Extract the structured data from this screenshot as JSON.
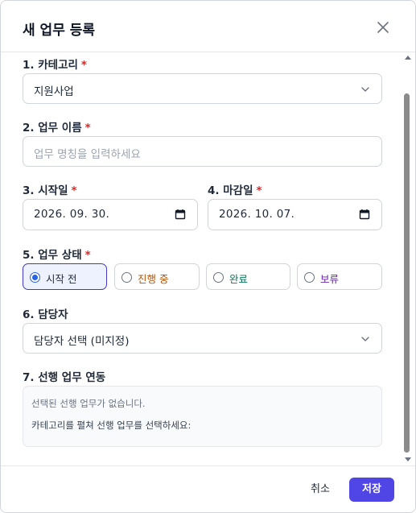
{
  "modal": {
    "title": "새 업무 등록"
  },
  "fields": {
    "category": {
      "number": "1.",
      "label": "카테고리",
      "required": "*",
      "value": "지원사업"
    },
    "task_name": {
      "number": "2.",
      "label": "업무 이름",
      "required": "*",
      "placeholder": "업무 명칭을 입력하세요"
    },
    "start_date": {
      "number": "3.",
      "label": "시작일",
      "required": "*",
      "value": "2026. 09. 30."
    },
    "due_date": {
      "number": "4.",
      "label": "마감일",
      "required": "*",
      "value": "2026. 10. 07."
    },
    "status": {
      "number": "5.",
      "label": "업무 상태",
      "required": "*",
      "options": [
        {
          "label": "시작 전",
          "color": "#1f2937",
          "selected": true
        },
        {
          "label": "진행 중",
          "color": "#b45309",
          "selected": false
        },
        {
          "label": "완료",
          "color": "#047857",
          "selected": false
        },
        {
          "label": "보류",
          "color": "#6b21a8",
          "selected": false
        }
      ]
    },
    "assignee": {
      "number": "6.",
      "label": "담당자",
      "value": "담당자 선택 (미지정)"
    },
    "predecessor": {
      "number": "7.",
      "label": "선행 업무 연동",
      "empty_text": "선택된 선행 업무가 없습니다.",
      "hint_text": "카테고리를 펼쳐 선행 업무를 선택하세요:"
    }
  },
  "footer": {
    "cancel_label": "취소",
    "save_label": "저장"
  },
  "colors": {
    "accent": "#4f46e5",
    "required": "#dc2626",
    "selected_bg": "#eef2ff"
  }
}
